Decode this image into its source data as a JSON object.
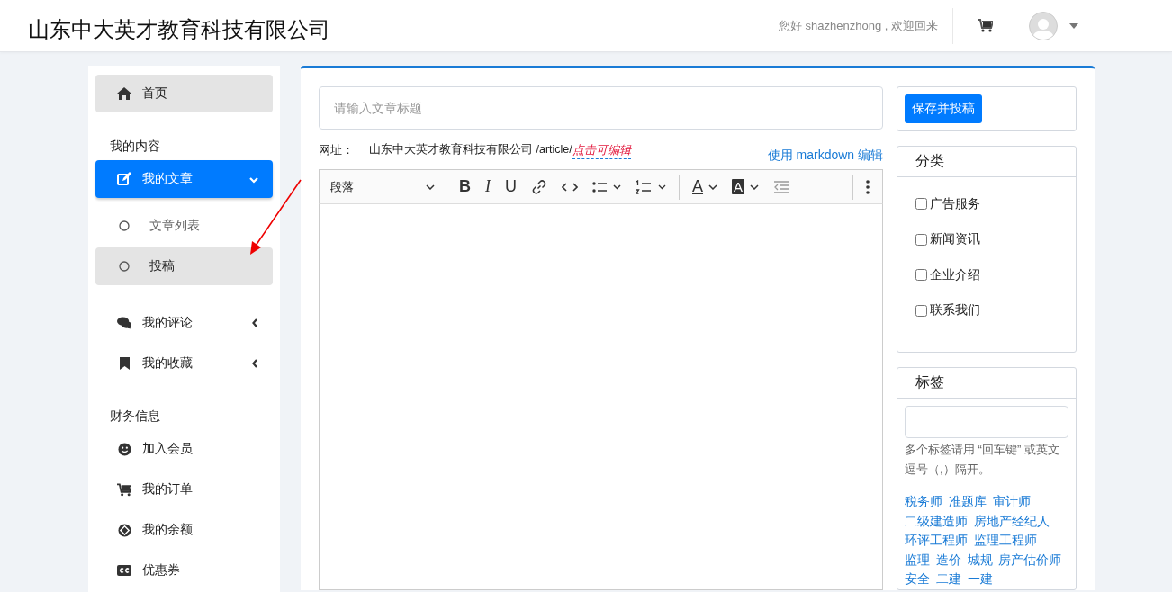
{
  "header": {
    "brand": "山东中大英才教育科技有限公司",
    "greeting": "您好 shazhenzhong , 欢迎回来"
  },
  "sidebar": {
    "items": [
      {
        "kind": "link",
        "label": "首页",
        "selected": true
      },
      {
        "kind": "heading",
        "label": "我的内容"
      },
      {
        "kind": "group",
        "label": "我的文章",
        "expanded": true,
        "children": [
          {
            "label": "文章列表",
            "selected": false
          },
          {
            "label": "投稿",
            "selected": true
          }
        ]
      },
      {
        "kind": "group",
        "label": "我的评论",
        "expanded": false
      },
      {
        "kind": "group",
        "label": "我的收藏",
        "expanded": false
      },
      {
        "kind": "heading",
        "label": "财务信息"
      },
      {
        "kind": "link",
        "label": "加入会员",
        "selected": false
      },
      {
        "kind": "link",
        "label": "我的订单",
        "selected": false
      },
      {
        "kind": "link",
        "label": "我的余额",
        "selected": false
      },
      {
        "kind": "link",
        "label": "优惠券",
        "selected": false
      }
    ]
  },
  "editor": {
    "title_field": {
      "placeholder": "请输入文章标题"
    },
    "url_label": "网址：",
    "url_base": "山东中大英才教育科技有限公司 /article/",
    "url_edit": "点击可编辑",
    "markdown_link": "使用 markdown 编辑",
    "toolbar": [
      {
        "kind": "block",
        "label": "段落"
      },
      {
        "kind": "bold",
        "label": "B"
      },
      {
        "kind": "italic",
        "label": "I"
      },
      {
        "kind": "underline",
        "label": "U"
      },
      {
        "kind": "link"
      },
      {
        "kind": "code"
      },
      {
        "kind": "bullets"
      },
      {
        "kind": "numbers"
      },
      {
        "kind": "color",
        "label": "A"
      },
      {
        "kind": "highlight",
        "label": "A"
      },
      {
        "kind": "outdent"
      },
      {
        "kind": "more"
      }
    ]
  },
  "aside": {
    "submit_button": "保存并投稿",
    "categories": {
      "title": "分类",
      "options": [
        {
          "label": "广告服务",
          "checked": false
        },
        {
          "label": "新闻资讯",
          "checked": false
        },
        {
          "label": "企业介绍",
          "checked": false
        },
        {
          "label": "联系我们",
          "checked": false
        }
      ]
    },
    "tags": {
      "title": "标签",
      "hint": "多个标签请用 “回车键” 或英文逗号（,）隔开。",
      "items": [
        "税务师",
        "准题库",
        "审计师",
        "二级建造师",
        "房地产经纪人",
        "环评工程师",
        "监理工程师",
        "监理",
        "造价",
        "城规",
        "房产估价师",
        "安全",
        "二建",
        "一建"
      ]
    }
  }
}
